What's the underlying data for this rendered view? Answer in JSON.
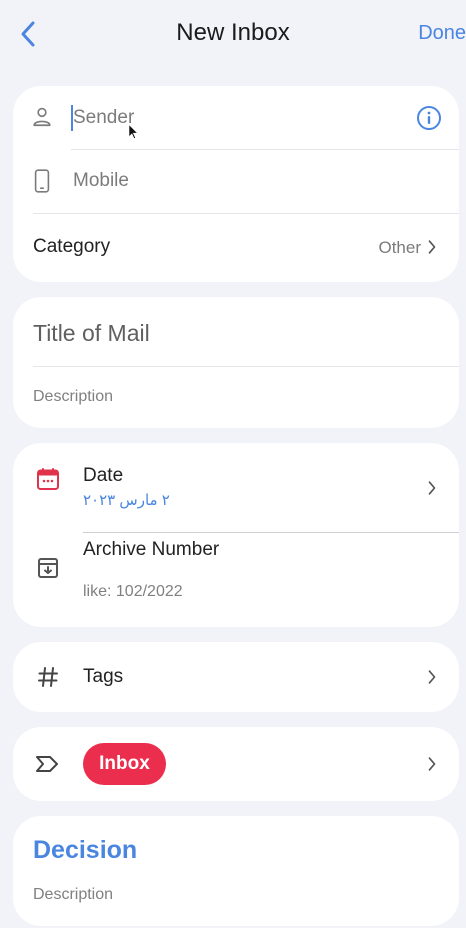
{
  "nav": {
    "title": "New Inbox",
    "done_label": "Done"
  },
  "contact": {
    "sender_placeholder": "Sender",
    "mobile_placeholder": "Mobile",
    "category_label": "Category",
    "category_value": "Other"
  },
  "mail": {
    "title_placeholder": "Title of Mail",
    "description_placeholder": "Description"
  },
  "details": {
    "date_label": "Date",
    "date_value": "٢ مارس ٢٠٢٣",
    "archive_label": "Archive Number",
    "archive_placeholder": "like: 102/2022"
  },
  "tags": {
    "label": "Tags"
  },
  "status": {
    "badge": "Inbox"
  },
  "decision": {
    "title": "Decision",
    "description_placeholder": "Description"
  },
  "colors": {
    "accent": "#4a86e0",
    "date_icon": "#e0344d",
    "badge": "#ec2e4e",
    "background": "#f2f2f9"
  },
  "icons": [
    "back-chevron-icon",
    "person-icon",
    "info-icon",
    "phone-icon",
    "chevron-right-icon",
    "calendar-icon",
    "archive-icon",
    "hashtag-icon",
    "label-tag-icon"
  ]
}
